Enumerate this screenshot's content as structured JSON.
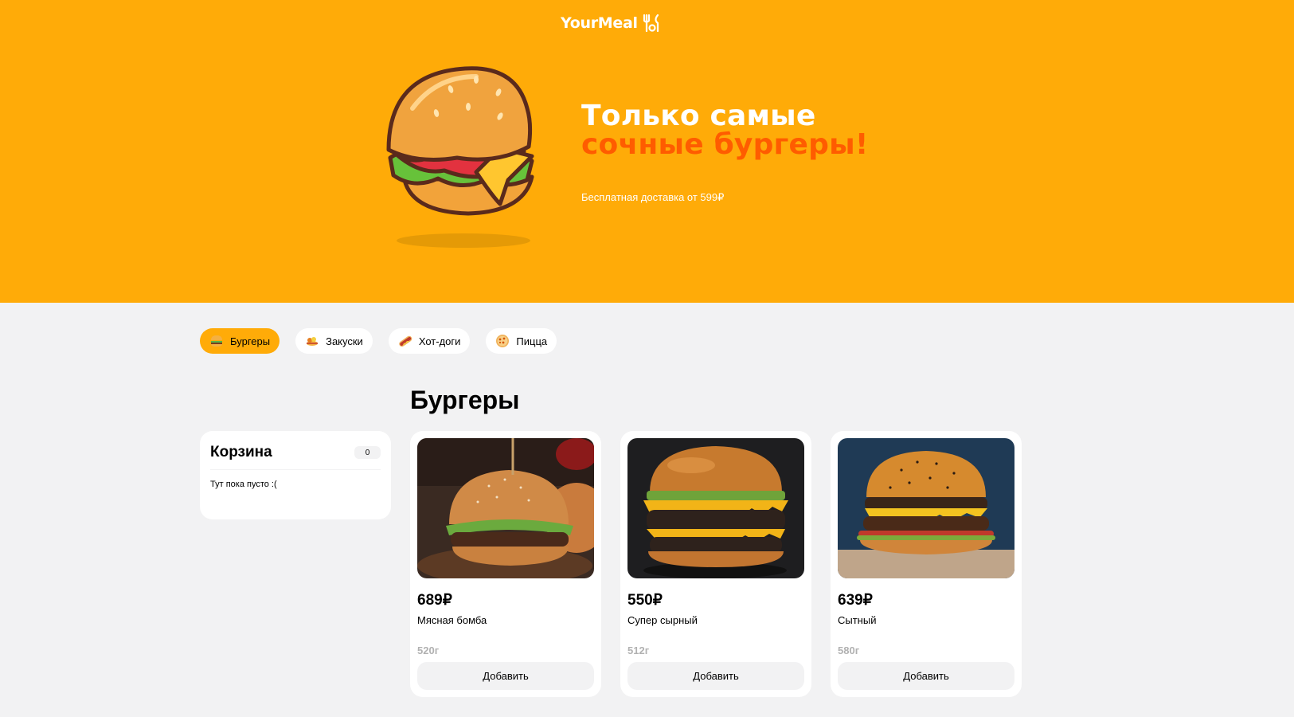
{
  "header": {
    "logo_text": "YourMeal",
    "logo_icon": "utensils-icon",
    "hero_title_line1": "Только самые",
    "hero_title_line2": "сочные бургеры!",
    "hero_subtitle": "Бесплатная доставка от 599₽",
    "hero_image": "burger-illustration"
  },
  "nav": {
    "items": [
      {
        "label": "Бургеры",
        "icon": "burger-icon",
        "active": true
      },
      {
        "label": "Закуски",
        "icon": "snack-icon",
        "active": false
      },
      {
        "label": "Хот-доги",
        "icon": "hotdog-icon",
        "active": false
      },
      {
        "label": "Пицца",
        "icon": "pizza-icon",
        "active": false
      }
    ]
  },
  "section": {
    "title": "Бургеры"
  },
  "cart": {
    "title": "Корзина",
    "count": "0",
    "empty_text": "Тут пока пусто :("
  },
  "products": [
    {
      "price": "689₽",
      "name": "Мясная бомба",
      "weight": "520г",
      "button": "Добавить",
      "image": "burger-photo-meat-bomb"
    },
    {
      "price": "550₽",
      "name": "Супер сырный",
      "weight": "512г",
      "button": "Добавить",
      "image": "burger-photo-super-cheese"
    },
    {
      "price": "639₽",
      "name": "Сытный",
      "weight": "580г",
      "button": "Добавить",
      "image": "burger-photo-hearty"
    }
  ],
  "colors": {
    "accent": "#FFAB08",
    "highlight": "#FF5C00",
    "background": "#F2F2F3"
  }
}
